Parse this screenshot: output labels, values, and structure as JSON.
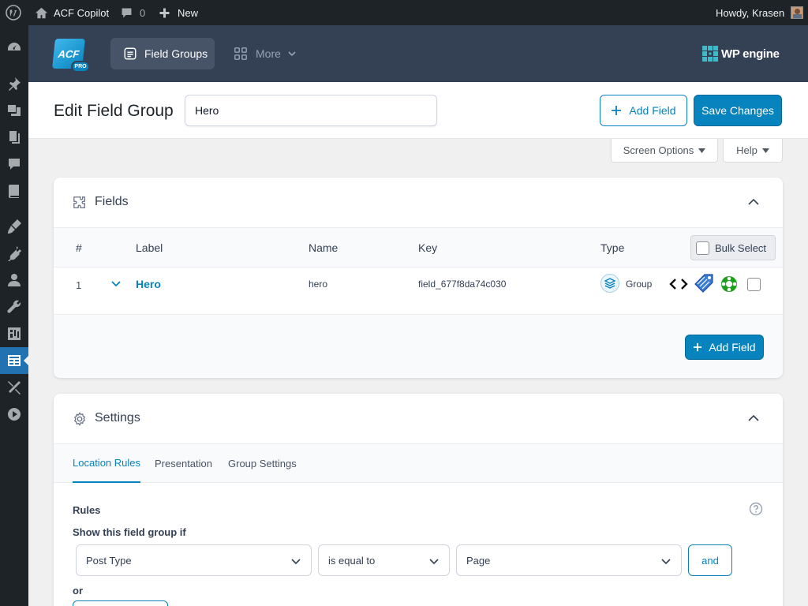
{
  "admin_bar": {
    "site_name": "ACF Copilot",
    "comments_count": "0",
    "new_label": "New",
    "greeting": "Howdy, Krasen"
  },
  "header": {
    "logo_text": "ACF",
    "logo_badge": "PRO",
    "nav_field_groups": "Field Groups",
    "nav_more": "More",
    "brand": "WP engine"
  },
  "title_bar": {
    "page_title": "Edit Field Group",
    "title_value": "Hero",
    "add_field_label": "Add Field",
    "save_label": "Save Changes"
  },
  "screen_meta": {
    "screen_options": "Screen Options",
    "help": "Help"
  },
  "fields_panel": {
    "title": "Fields",
    "columns": {
      "num": "#",
      "label": "Label",
      "name": "Name",
      "key": "Key",
      "type": "Type"
    },
    "bulk_select": "Bulk Select",
    "rows": [
      {
        "num": "1",
        "label": "Hero",
        "name": "hero",
        "key": "field_677f8da74c030",
        "type": "Group"
      }
    ],
    "add_field_label": "Add Field"
  },
  "settings_panel": {
    "title": "Settings",
    "tabs": [
      "Location Rules",
      "Presentation",
      "Group Settings"
    ],
    "rules_label": "Rules",
    "show_if_label": "Show this field group if",
    "rule": {
      "param": "Post Type",
      "operator": "is equal to",
      "value": "Page"
    },
    "and_label": "and",
    "or_label": "or"
  },
  "colors": {
    "accent": "#0783be",
    "header_bg": "#344054",
    "admin_bar": "#1d2327",
    "active_menu": "#2271b1"
  }
}
